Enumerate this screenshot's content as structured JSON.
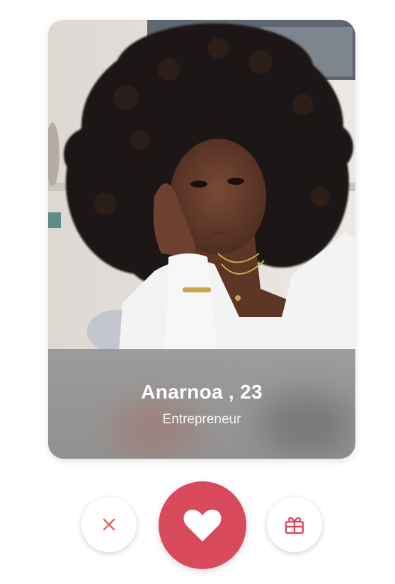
{
  "profile": {
    "name": "Anarnoa , 23",
    "occupation": "Entrepreneur"
  },
  "actions": {
    "dislike_icon": "close-icon",
    "like_icon": "heart-icon",
    "gift_icon": "gift-icon"
  },
  "colors": {
    "accent": "#d84a5c",
    "dislike": "#e86a4a",
    "gift": "#d84a5c"
  }
}
